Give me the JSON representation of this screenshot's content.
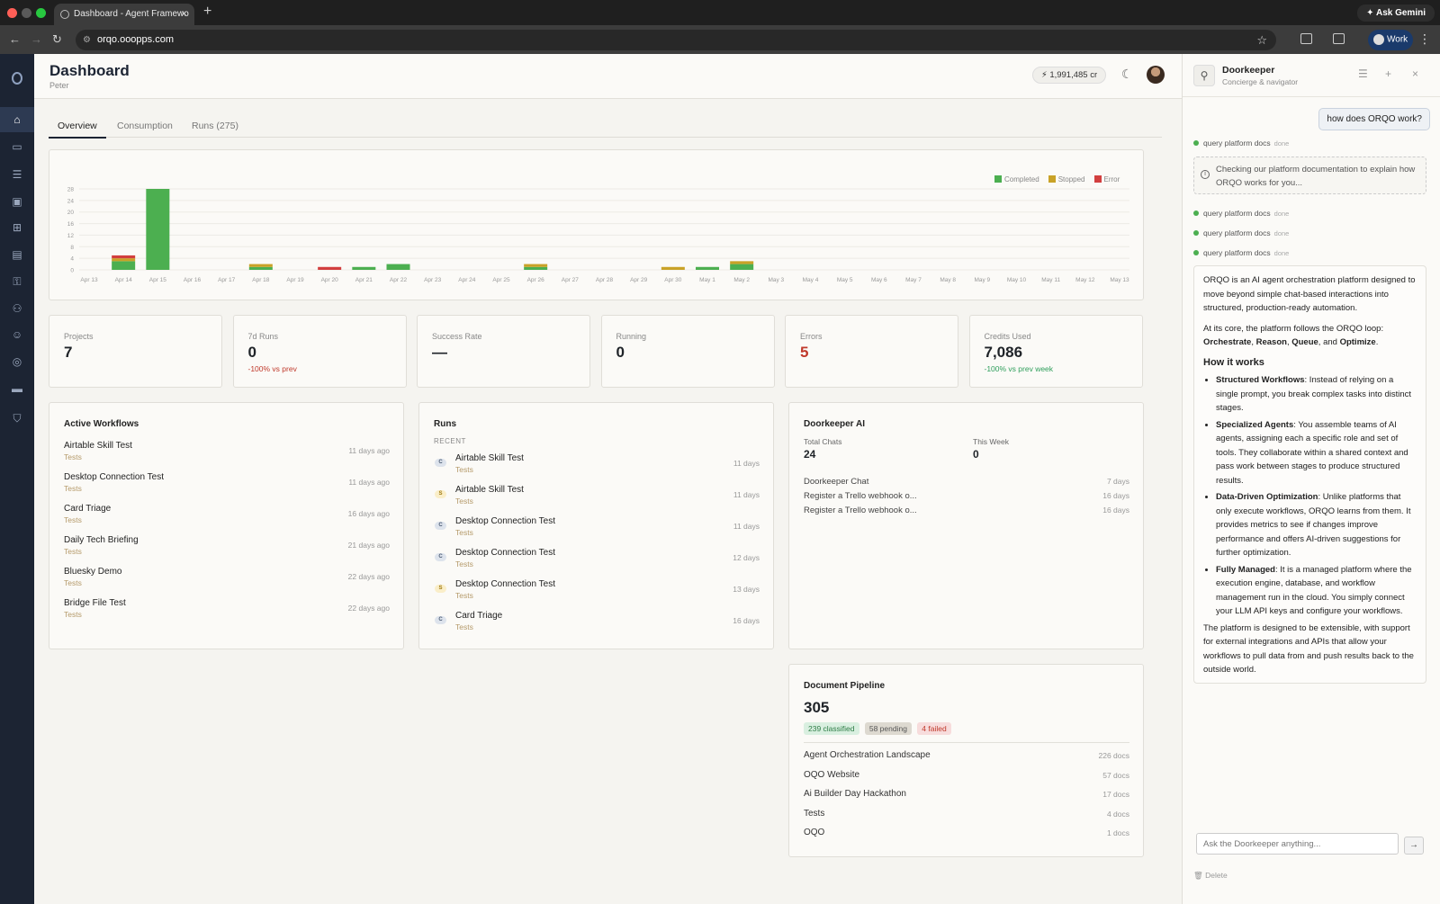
{
  "browser": {
    "tab_title": "Dashboard - Agent Framewo",
    "url": "orqo.ooopps.com",
    "ask_gemini": "Ask Gemini",
    "profile": "Work"
  },
  "header": {
    "title": "Dashboard",
    "subtitle": "Peter",
    "credits": "1,991,485 cr"
  },
  "tabs": [
    "Overview",
    "Consumption",
    "Runs (275)"
  ],
  "chart_data": {
    "type": "bar",
    "stacked": true,
    "categories": [
      "Apr 13",
      "Apr 14",
      "Apr 15",
      "Apr 16",
      "Apr 17",
      "Apr 18",
      "Apr 19",
      "Apr 20",
      "Apr 21",
      "Apr 22",
      "Apr 23",
      "Apr 24",
      "Apr 25",
      "Apr 26",
      "Apr 27",
      "Apr 28",
      "Apr 29",
      "Apr 30",
      "May 1",
      "May 2",
      "May 3",
      "May 4",
      "May 5",
      "May 6",
      "May 7",
      "May 8",
      "May 9",
      "May 10",
      "May 11",
      "May 12",
      "May 13"
    ],
    "series": [
      {
        "name": "Completed",
        "color": "#4caf50",
        "values": [
          0,
          3,
          28,
          0,
          0,
          1,
          0,
          0,
          1,
          2,
          0,
          0,
          0,
          1,
          0,
          0,
          0,
          0,
          1,
          2,
          0,
          0,
          0,
          0,
          0,
          0,
          0,
          0,
          0,
          0,
          0
        ]
      },
      {
        "name": "Stopped",
        "color": "#c9a227",
        "values": [
          0,
          1,
          0,
          0,
          0,
          1,
          0,
          0,
          0,
          0,
          0,
          0,
          0,
          1,
          0,
          0,
          0,
          1,
          0,
          1,
          0,
          0,
          0,
          0,
          0,
          0,
          0,
          0,
          0,
          0,
          0
        ]
      },
      {
        "name": "Error",
        "color": "#d23f3f",
        "values": [
          0,
          1,
          0,
          0,
          0,
          0,
          0,
          1,
          0,
          0,
          0,
          0,
          0,
          0,
          0,
          0,
          0,
          0,
          0,
          0,
          0,
          0,
          0,
          0,
          0,
          0,
          0,
          0,
          0,
          0,
          0
        ]
      }
    ],
    "yticks": [
      0,
      4,
      8,
      12,
      16,
      20,
      24,
      28
    ],
    "ylim": [
      0,
      28
    ],
    "grid": true,
    "legend": "top-right"
  },
  "stats": [
    {
      "label": "Projects",
      "value": "7",
      "sub": ""
    },
    {
      "label": "7d Runs",
      "value": "0",
      "sub": "-100% vs prev"
    },
    {
      "label": "Success Rate",
      "value": "—",
      "sub": ""
    },
    {
      "label": "Running",
      "value": "0",
      "sub": ""
    },
    {
      "label": "Errors",
      "value": "5",
      "sub": ""
    },
    {
      "label": "Credits Used",
      "value": "7,086",
      "sub": "-100% vs prev week"
    }
  ],
  "active_workflows": {
    "title": "Active Workflows",
    "items": [
      {
        "name": "Airtable Skill Test",
        "tag": "Tests",
        "ago": "11 days ago"
      },
      {
        "name": "Desktop Connection Test",
        "tag": "Tests",
        "ago": "11 days ago"
      },
      {
        "name": "Card Triage",
        "tag": "Tests",
        "ago": "16 days ago"
      },
      {
        "name": "Daily Tech Briefing",
        "tag": "Tests",
        "ago": "21 days ago"
      },
      {
        "name": "Bluesky Demo",
        "tag": "Tests",
        "ago": "22 days ago"
      },
      {
        "name": "Bridge File Test",
        "tag": "Tests",
        "ago": "22 days ago"
      }
    ]
  },
  "runs": {
    "title": "Runs",
    "section": "RECENT",
    "items": [
      {
        "badge": "C",
        "name": "Airtable Skill Test",
        "tag": "Tests",
        "ago": "11 days"
      },
      {
        "badge": "S",
        "name": "Airtable Skill Test",
        "tag": "Tests",
        "ago": "11 days"
      },
      {
        "badge": "C",
        "name": "Desktop Connection Test",
        "tag": "Tests",
        "ago": "11 days"
      },
      {
        "badge": "C",
        "name": "Desktop Connection Test",
        "tag": "Tests",
        "ago": "12 days"
      },
      {
        "badge": "S",
        "name": "Desktop Connection Test",
        "tag": "Tests",
        "ago": "13 days"
      },
      {
        "badge": "C",
        "name": "Card Triage",
        "tag": "Tests",
        "ago": "16 days"
      }
    ]
  },
  "doorkeeper_ai": {
    "title": "Doorkeeper AI",
    "total_label": "Total Chats",
    "total_value": "24",
    "week_label": "This Week",
    "week_value": "0",
    "items": [
      {
        "name": "Doorkeeper Chat",
        "ago": "7 days"
      },
      {
        "name": "Register a Trello webhook o...",
        "ago": "16 days"
      },
      {
        "name": "Register a Trello webhook o...",
        "ago": "16 days"
      }
    ]
  },
  "pipeline": {
    "title": "Document Pipeline",
    "total": "305",
    "classified": "239 classified",
    "pending": "58 pending",
    "failed": "4 failed",
    "items": [
      {
        "name": "Agent Orchestration Landscape",
        "count": "226 docs"
      },
      {
        "name": "OQO Website",
        "count": "57 docs"
      },
      {
        "name": "Ai Builder Day Hackathon",
        "count": "17 docs"
      },
      {
        "name": "Tests",
        "count": "4 docs"
      },
      {
        "name": "OQO",
        "count": "1 docs"
      }
    ]
  },
  "panel": {
    "title": "Doorkeeper",
    "subtitle": "Concierge & navigator",
    "user_msg": "how does ORQO work?",
    "tool_label": "query platform docs",
    "tool_status": "done",
    "thinking": "Checking our platform documentation to explain how ORQO works for you...",
    "intro": "ORQO is an AI agent orchestration platform designed to move beyond simple chat-based interactions into structured, production-ready automation.",
    "loop_pre": "At its core, the platform follows the ORQO loop: ",
    "loop_1": "Orchestrate",
    "loop_2": "Reason",
    "loop_3": "Queue",
    "loop_and": "and",
    "loop_4": "Optimize",
    "how_heading": "How it works",
    "points": [
      {
        "title": "Structured Workflows",
        "text": ": Instead of relying on a single prompt, you break complex tasks into distinct stages."
      },
      {
        "title": "Specialized Agents",
        "text": ": You assemble teams of AI agents, assigning each a specific role and set of tools. They collaborate within a shared context and pass work between stages to produce structured results."
      },
      {
        "title": "Data-Driven Optimization",
        "text": ": Unlike platforms that only execute workflows, ORQO learns from them. It provides metrics to see if changes improve performance and offers AI-driven suggestions for further optimization."
      },
      {
        "title": "Fully Managed",
        "text": ": It is a managed platform where the execution engine, database, and workflow management run in the cloud. You simply connect your LLM API keys and configure your workflows."
      }
    ],
    "outro": "The platform is designed to be extensible, with support for external integrations and APIs that allow your workflows to pull data from and push results back to the outside world.",
    "input_placeholder": "Ask the Doorkeeper anything...",
    "delete_label": "Delete"
  },
  "colors": {
    "sidebar": "#1c2433",
    "completed": "#4caf50",
    "stopped": "#c9a227",
    "error": "#d23f3f",
    "negative": "#c0392b",
    "positive": "#2e9e5b"
  }
}
